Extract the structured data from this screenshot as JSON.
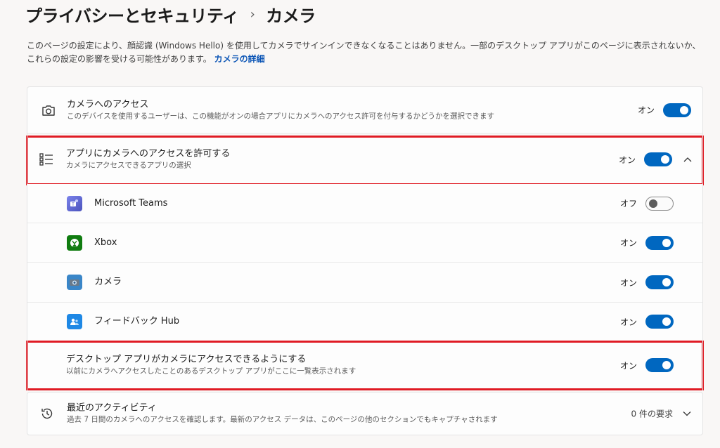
{
  "breadcrumb": {
    "parent": "プライバシーとセキュリティ",
    "separator": "›",
    "current": "カメラ"
  },
  "description": {
    "text": "このページの設定により、顔認識 (Windows Hello) を使用してカメラでサインインできなくなることはありません。一部のデスクトップ アプリがこのページに表示されないか、これらの設定の影響を受ける可能性があります。",
    "link": "カメラの詳細"
  },
  "camera_access": {
    "title": "カメラへのアクセス",
    "subtitle": "このデバイスを使用するユーザーは、この機能がオンの場合アプリにカメラへのアクセス許可を付与するかどうかを選択できます",
    "state": "オン",
    "on": true
  },
  "app_access": {
    "title": "アプリにカメラへのアクセスを許可する",
    "subtitle": "カメラにアクセスできるアプリの選択",
    "state": "オン",
    "on": true
  },
  "apps": [
    {
      "name": "Microsoft Teams",
      "state": "オフ",
      "on": false,
      "icon": "teams-icon"
    },
    {
      "name": "Xbox",
      "state": "オン",
      "on": true,
      "icon": "xbox-icon"
    },
    {
      "name": "カメラ",
      "state": "オン",
      "on": true,
      "icon": "camera-app-icon"
    },
    {
      "name": "フィードバック Hub",
      "state": "オン",
      "on": true,
      "icon": "feedback-hub-icon"
    }
  ],
  "desktop_access": {
    "title": "デスクトップ アプリがカメラにアクセスできるようにする",
    "subtitle": "以前にカメラへアクセスしたことのあるデスクトップ アプリがここに一覧表示されます",
    "state": "オン",
    "on": true
  },
  "recent_activity": {
    "title": "最近のアクティビティ",
    "subtitle": "過去 7 日間のカメラへのアクセスを確認します。最新のアクセス データは、このページの他のセクションでもキャプチャされます",
    "count": "0 件の要求"
  },
  "colors": {
    "accent": "#0067c0",
    "highlight": "#e01b24"
  }
}
